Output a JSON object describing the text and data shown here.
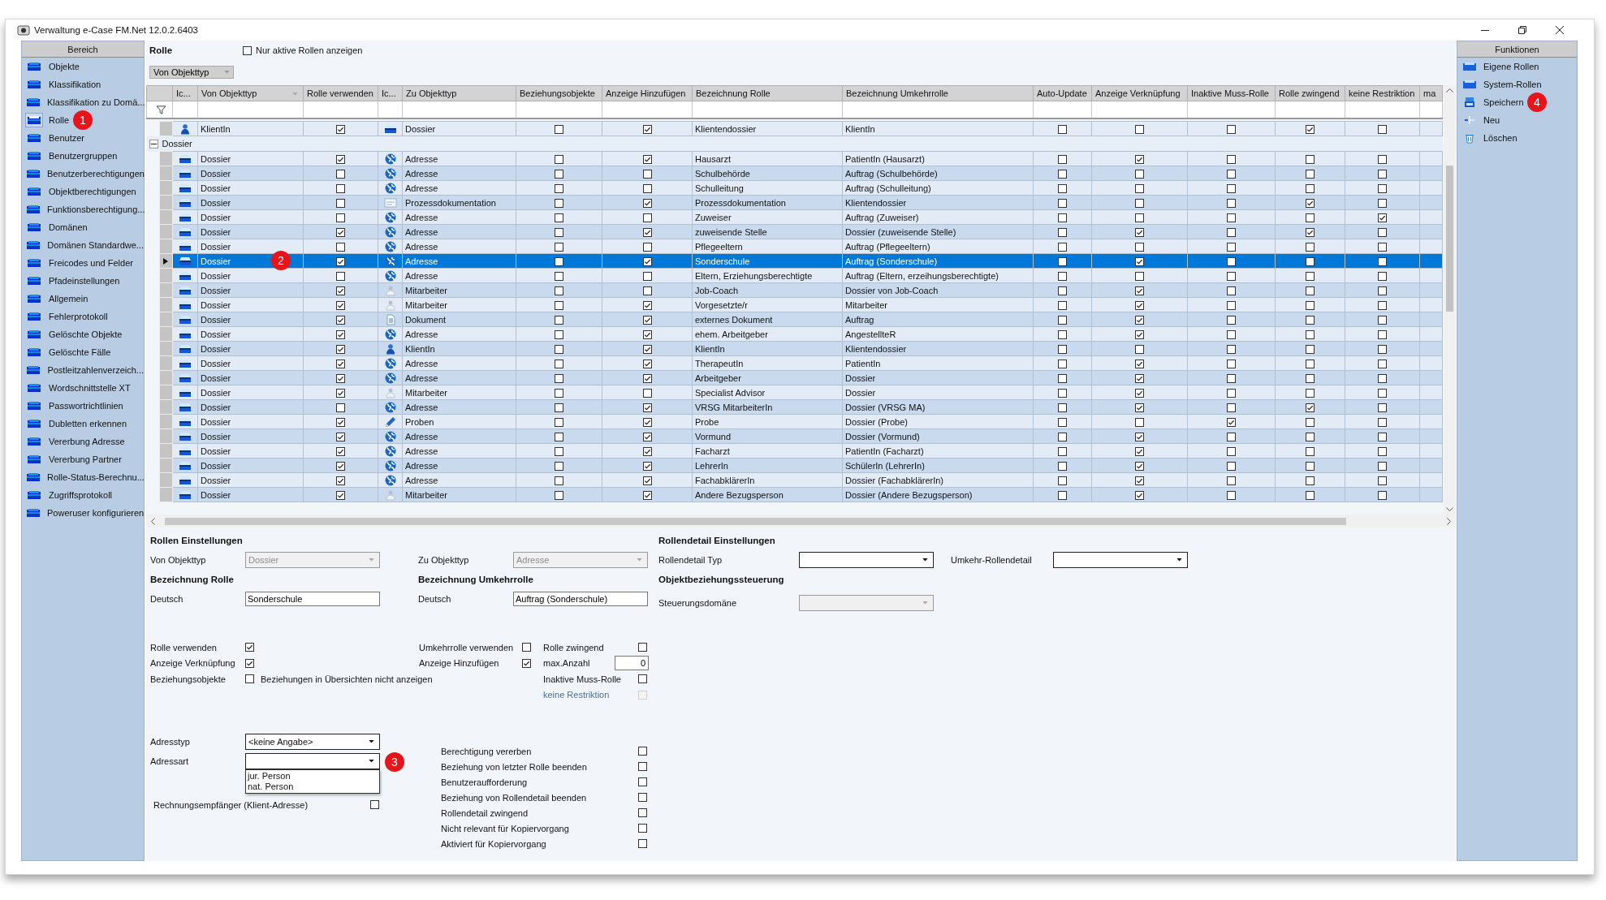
{
  "window": {
    "title": "Verwaltung e-Case FM.Net 12.0.2.6403"
  },
  "sidebar": {
    "title": "Bereich",
    "items": [
      {
        "label": "Objekte",
        "selected": false
      },
      {
        "label": "Klassifikation",
        "selected": false
      },
      {
        "label": "Klassifikation zu Domä...",
        "selected": false
      },
      {
        "label": "Rolle",
        "selected": true,
        "callout": "1"
      },
      {
        "label": "Benutzer",
        "selected": false
      },
      {
        "label": "Benutzergruppen",
        "selected": false
      },
      {
        "label": "Benutzerberechtigungen",
        "selected": false
      },
      {
        "label": "Objektberechtigungen",
        "selected": false
      },
      {
        "label": "Funktionsberechtigung...",
        "selected": false
      },
      {
        "label": "Domänen",
        "selected": false
      },
      {
        "label": "Domänen Standardwe...",
        "selected": false
      },
      {
        "label": "Freicodes und Felder",
        "selected": false
      },
      {
        "label": "Pfadeinstellungen",
        "selected": false
      },
      {
        "label": "Allgemein",
        "selected": false
      },
      {
        "label": "Fehlerprotokoll",
        "selected": false
      },
      {
        "label": "Gelöschte Objekte",
        "selected": false
      },
      {
        "label": "Gelöschte Fälle",
        "selected": false
      },
      {
        "label": "Postleitzahlenverzeich...",
        "selected": false
      },
      {
        "label": "Wordschnittstelle XT",
        "selected": false
      },
      {
        "label": "Passwortrichtlinien",
        "selected": false
      },
      {
        "label": "Dubletten erkennen",
        "selected": false
      },
      {
        "label": "Vererbung Adresse",
        "selected": false
      },
      {
        "label": "Vererbung Partner",
        "selected": false
      },
      {
        "label": "Rolle-Status-Berechnu...",
        "selected": false
      },
      {
        "label": "Zugriffsprotokoll",
        "selected": false
      },
      {
        "label": "Poweruser konfigurieren",
        "selected": false
      }
    ]
  },
  "main": {
    "title": "Rolle",
    "active_only": {
      "label": "Nur aktive Rollen anzeigen",
      "checked": false
    },
    "group_by": "Von Objekttyp"
  },
  "grid": {
    "columns": [
      "Ic...",
      "Von Objekttyp",
      "Rolle verwenden",
      "Ic...",
      "Zu Objekttyp",
      "Beziehungsobjekte",
      "Anzeige Hinzufügen",
      "Bezeichnung Rolle",
      "Bezeichnung Umkehrrolle",
      "Auto-Update",
      "Anzeige Verknüpfung",
      "Inaktive Muss-Rolle",
      "Rolle zwingend",
      "keine Restriktion",
      "ma"
    ],
    "pinned_row": {
      "from": {
        "kind": "client",
        "label": "KlientIn"
      },
      "use_role": true,
      "to": {
        "kind": "dossier",
        "label": "Dossier"
      },
      "relation_objects": false,
      "show_add": true,
      "role": "Klientendossier",
      "reverse_role": "KlientIn",
      "auto_update": false,
      "show_link": false,
      "inactive_required": false,
      "role_required": true,
      "no_restriction": false
    },
    "group": {
      "label": "Dossier",
      "expanded": true
    },
    "rows": [
      {
        "from": {
          "kind": "dossier",
          "label": "Dossier"
        },
        "use_role": true,
        "to": {
          "kind": "address",
          "label": "Adresse"
        },
        "relation_objects": false,
        "show_add": true,
        "role": "Hausarzt",
        "reverse_role": "PatientIn (Hausarzt)",
        "auto_update": false,
        "show_link": true,
        "inactive_required": false,
        "role_required": false,
        "no_restriction": false,
        "selected": false
      },
      {
        "from": {
          "kind": "dossier",
          "label": "Dossier"
        },
        "use_role": false,
        "to": {
          "kind": "address",
          "label": "Adresse"
        },
        "relation_objects": false,
        "show_add": false,
        "role": "Schulbehörde",
        "reverse_role": "Auftrag (Schulbehörde)",
        "auto_update": false,
        "show_link": false,
        "inactive_required": false,
        "role_required": false,
        "no_restriction": false,
        "selected": false
      },
      {
        "from": {
          "kind": "dossier",
          "label": "Dossier"
        },
        "use_role": false,
        "to": {
          "kind": "address",
          "label": "Adresse"
        },
        "relation_objects": false,
        "show_add": false,
        "role": "Schulleitung",
        "reverse_role": "Auftrag (Schulleitung)",
        "auto_update": false,
        "show_link": false,
        "inactive_required": false,
        "role_required": false,
        "no_restriction": false,
        "selected": false
      },
      {
        "from": {
          "kind": "dossier",
          "label": "Dossier"
        },
        "use_role": false,
        "to": {
          "kind": "process",
          "label": "Prozessdokumentation"
        },
        "relation_objects": false,
        "show_add": true,
        "role": "Prozessdokumentation",
        "reverse_role": "Klientendossier",
        "auto_update": false,
        "show_link": false,
        "inactive_required": false,
        "role_required": true,
        "no_restriction": false,
        "selected": false
      },
      {
        "from": {
          "kind": "dossier",
          "label": "Dossier"
        },
        "use_role": false,
        "to": {
          "kind": "address",
          "label": "Adresse"
        },
        "relation_objects": false,
        "show_add": false,
        "role": "Zuweiser",
        "reverse_role": "Auftrag (Zuweiser)",
        "auto_update": false,
        "show_link": false,
        "inactive_required": false,
        "role_required": false,
        "no_restriction": true,
        "selected": false
      },
      {
        "from": {
          "kind": "dossier",
          "label": "Dossier"
        },
        "use_role": true,
        "to": {
          "kind": "address",
          "label": "Adresse"
        },
        "relation_objects": false,
        "show_add": true,
        "role": "zuweisende Stelle",
        "reverse_role": "Dossier (zuweisende Stelle)",
        "auto_update": false,
        "show_link": true,
        "inactive_required": false,
        "role_required": true,
        "no_restriction": false,
        "selected": false
      },
      {
        "from": {
          "kind": "dossier",
          "label": "Dossier"
        },
        "use_role": false,
        "to": {
          "kind": "address",
          "label": "Adresse"
        },
        "relation_objects": false,
        "show_add": false,
        "role": "Pflegeeltern",
        "reverse_role": "Auftrag (Pflegeeltern)",
        "auto_update": false,
        "show_link": false,
        "inactive_required": false,
        "role_required": false,
        "no_restriction": false,
        "selected": false
      },
      {
        "from": {
          "kind": "dossier",
          "label": "Dossier"
        },
        "use_role": true,
        "to": {
          "kind": "address",
          "label": "Adresse"
        },
        "relation_objects": false,
        "show_add": true,
        "role": "Sonderschule",
        "reverse_role": "Auftrag (Sonderschule)",
        "auto_update": false,
        "show_link": true,
        "inactive_required": false,
        "role_required": false,
        "no_restriction": false,
        "selected": true,
        "callout": "2"
      },
      {
        "from": {
          "kind": "dossier",
          "label": "Dossier"
        },
        "use_role": false,
        "to": {
          "kind": "address",
          "label": "Adresse"
        },
        "relation_objects": false,
        "show_add": false,
        "role": "Eltern, Erziehungsberechtigte",
        "reverse_role": "Auftrag (Eltern, erzeihungsberechtigte)",
        "auto_update": false,
        "show_link": false,
        "inactive_required": false,
        "role_required": false,
        "no_restriction": false,
        "selected": false
      },
      {
        "from": {
          "kind": "dossier",
          "label": "Dossier"
        },
        "use_role": true,
        "to": {
          "kind": "employee",
          "label": "Mitarbeiter"
        },
        "relation_objects": false,
        "show_add": false,
        "role": "Job-Coach",
        "reverse_role": "Dossier von Job-Coach",
        "auto_update": false,
        "show_link": true,
        "inactive_required": false,
        "role_required": false,
        "no_restriction": false,
        "selected": false
      },
      {
        "from": {
          "kind": "dossier",
          "label": "Dossier"
        },
        "use_role": true,
        "to": {
          "kind": "employee",
          "label": "Mitarbeiter"
        },
        "relation_objects": false,
        "show_add": true,
        "role": "Vorgesetzte/r",
        "reverse_role": "Mitarbeiter",
        "auto_update": false,
        "show_link": true,
        "inactive_required": false,
        "role_required": false,
        "no_restriction": false,
        "selected": false
      },
      {
        "from": {
          "kind": "dossier",
          "label": "Dossier"
        },
        "use_role": true,
        "to": {
          "kind": "document",
          "label": "Dokument"
        },
        "relation_objects": false,
        "show_add": true,
        "role": "externes Dokument",
        "reverse_role": "Auftrag",
        "auto_update": false,
        "show_link": true,
        "inactive_required": false,
        "role_required": false,
        "no_restriction": false,
        "selected": false
      },
      {
        "from": {
          "kind": "dossier",
          "label": "Dossier"
        },
        "use_role": true,
        "to": {
          "kind": "address",
          "label": "Adresse"
        },
        "relation_objects": false,
        "show_add": true,
        "role": "ehem. Arbeitgeber",
        "reverse_role": "AngestellteR",
        "auto_update": false,
        "show_link": true,
        "inactive_required": false,
        "role_required": false,
        "no_restriction": false,
        "selected": false
      },
      {
        "from": {
          "kind": "dossier",
          "label": "Dossier"
        },
        "use_role": true,
        "to": {
          "kind": "client",
          "label": "KlientIn"
        },
        "relation_objects": false,
        "show_add": true,
        "role": "KlientIn",
        "reverse_role": "Klientendossier",
        "auto_update": false,
        "show_link": false,
        "inactive_required": false,
        "role_required": false,
        "no_restriction": false,
        "selected": false
      },
      {
        "from": {
          "kind": "dossier",
          "label": "Dossier"
        },
        "use_role": true,
        "to": {
          "kind": "address",
          "label": "Adresse"
        },
        "relation_objects": false,
        "show_add": true,
        "role": "TherapeutIn",
        "reverse_role": "PatientIn",
        "auto_update": false,
        "show_link": true,
        "inactive_required": false,
        "role_required": false,
        "no_restriction": false,
        "selected": false
      },
      {
        "from": {
          "kind": "dossier",
          "label": "Dossier"
        },
        "use_role": true,
        "to": {
          "kind": "address",
          "label": "Adresse"
        },
        "relation_objects": false,
        "show_add": true,
        "role": "Arbeitgeber",
        "reverse_role": "Dossier",
        "auto_update": false,
        "show_link": true,
        "inactive_required": false,
        "role_required": false,
        "no_restriction": false,
        "selected": false
      },
      {
        "from": {
          "kind": "dossier",
          "label": "Dossier"
        },
        "use_role": true,
        "to": {
          "kind": "employee",
          "label": "Mitarbeiter"
        },
        "relation_objects": false,
        "show_add": false,
        "role": "Specialist Advisor",
        "reverse_role": "Dossier",
        "auto_update": false,
        "show_link": true,
        "inactive_required": false,
        "role_required": false,
        "no_restriction": false,
        "selected": false
      },
      {
        "from": {
          "kind": "dossier",
          "label": "Dossier"
        },
        "use_role": false,
        "to": {
          "kind": "address",
          "label": "Adresse"
        },
        "relation_objects": false,
        "show_add": true,
        "role": "VRSG MitarbeiterIn",
        "reverse_role": "Dossier (VRSG MA)",
        "auto_update": false,
        "show_link": true,
        "inactive_required": false,
        "role_required": true,
        "no_restriction": false,
        "selected": false
      },
      {
        "from": {
          "kind": "dossier",
          "label": "Dossier"
        },
        "use_role": true,
        "to": {
          "kind": "sample",
          "label": "Proben"
        },
        "relation_objects": false,
        "show_add": true,
        "role": "Probe",
        "reverse_role": "Dossier (Probe)",
        "auto_update": false,
        "show_link": false,
        "inactive_required": true,
        "role_required": false,
        "no_restriction": false,
        "selected": false
      },
      {
        "from": {
          "kind": "dossier",
          "label": "Dossier"
        },
        "use_role": true,
        "to": {
          "kind": "address",
          "label": "Adresse"
        },
        "relation_objects": false,
        "show_add": true,
        "role": "Vormund",
        "reverse_role": "Dossier (Vormund)",
        "auto_update": false,
        "show_link": true,
        "inactive_required": false,
        "role_required": false,
        "no_restriction": false,
        "selected": false
      },
      {
        "from": {
          "kind": "dossier",
          "label": "Dossier"
        },
        "use_role": true,
        "to": {
          "kind": "address",
          "label": "Adresse"
        },
        "relation_objects": false,
        "show_add": true,
        "role": "Facharzt",
        "reverse_role": "PatientIn (Facharzt)",
        "auto_update": false,
        "show_link": true,
        "inactive_required": false,
        "role_required": false,
        "no_restriction": false,
        "selected": false
      },
      {
        "from": {
          "kind": "dossier",
          "label": "Dossier"
        },
        "use_role": true,
        "to": {
          "kind": "address",
          "label": "Adresse"
        },
        "relation_objects": false,
        "show_add": true,
        "role": "LehrerIn",
        "reverse_role": "SchülerIn (LehrerIn)",
        "auto_update": false,
        "show_link": true,
        "inactive_required": false,
        "role_required": false,
        "no_restriction": false,
        "selected": false
      },
      {
        "from": {
          "kind": "dossier",
          "label": "Dossier"
        },
        "use_role": true,
        "to": {
          "kind": "address",
          "label": "Adresse"
        },
        "relation_objects": false,
        "show_add": true,
        "role": "FachabklärerIn",
        "reverse_role": "Dossier (FachabklärerIn)",
        "auto_update": false,
        "show_link": true,
        "inactive_required": false,
        "role_required": false,
        "no_restriction": false,
        "selected": false
      },
      {
        "from": {
          "kind": "dossier",
          "label": "Dossier"
        },
        "use_role": true,
        "to": {
          "kind": "employee",
          "label": "Mitarbeiter"
        },
        "relation_objects": false,
        "show_add": true,
        "role": "Andere Bezugsperson",
        "reverse_role": "Dossier (Andere Bezugsperson)",
        "auto_update": false,
        "show_link": true,
        "inactive_required": false,
        "role_required": false,
        "no_restriction": false,
        "selected": false
      }
    ]
  },
  "form": {
    "role_settings": {
      "title": "Rollen Einstellungen",
      "from_type": {
        "label": "Von Objekttyp",
        "value": "Dossier",
        "disabled": true
      },
      "to_type": {
        "label": "Zu Objekttyp",
        "value": "Adresse",
        "disabled": true
      }
    },
    "detail_settings": {
      "title": "Rollendetail Einstellungen",
      "detail_type": {
        "label": "Rollendetail Typ",
        "disabled": false
      },
      "reverse_detail": {
        "label": "Umkehr-Rollendetail",
        "disabled": false
      }
    },
    "role_name": {
      "title": "Bezeichnung Rolle",
      "label": "Deutsch",
      "value": "Sonderschule"
    },
    "reverse_name": {
      "title": "Bezeichnung Umkehrrolle",
      "label": "Deutsch",
      "value": "Auftrag (Sonderschule)"
    },
    "control": {
      "title": "Objektbeziehungssteuerung",
      "domain": {
        "label": "Steuerungsdomäne",
        "disabled": true
      }
    },
    "flags_left": [
      {
        "label": "Rolle verwenden",
        "checked": true
      },
      {
        "label": "Anzeige Verknüpfung",
        "checked": true
      },
      {
        "label": "Beziehungsobjekte",
        "checked": false,
        "note": "Beziehungen in Übersichten nicht anzeigen"
      }
    ],
    "flags_mid": [
      {
        "label": "Umkehrrolle verwenden",
        "checked": false
      },
      {
        "label": "Anzeige Hinzufügen",
        "checked": true
      }
    ],
    "flags_right": [
      {
        "kind": "checkbox",
        "label": "Rolle zwingend",
        "checked": false,
        "disabled": false
      },
      {
        "kind": "number",
        "label": "max.Anzahl",
        "value": "0"
      },
      {
        "kind": "checkbox",
        "label": "Inaktive Muss-Rolle",
        "checked": false,
        "disabled": false
      },
      {
        "kind": "checkbox",
        "label": "keine Restriktion",
        "checked": false,
        "disabled": true
      }
    ],
    "address_type": {
      "label": "Adresstyp",
      "value": "<keine Angabe>"
    },
    "address_kind": {
      "label": "Adressart",
      "expanded": true,
      "options": [
        "jur. Person",
        "nat. Person"
      ],
      "callout": "3"
    },
    "invoice": {
      "label": "Rechnungsempfänger (Klient-Adresse)",
      "checked": false
    },
    "options": [
      {
        "label": "Berechtigung vererben",
        "checked": false
      },
      {
        "label": "Beziehung von letzter Rolle beenden",
        "checked": false
      },
      {
        "label": "Benutzeraufforderung",
        "checked": false
      },
      {
        "label": "Beziehung von Rollendetail beenden",
        "checked": false
      },
      {
        "label": "Rollendetail zwingend",
        "checked": false
      },
      {
        "label": "Nicht relevant für Kopiervorgang",
        "checked": false
      },
      {
        "label": "Aktiviert für Kopiervorgang",
        "checked": false
      }
    ]
  },
  "functions": {
    "title": "Funktionen",
    "items": [
      {
        "label": "Eigene Rollen",
        "kind": "roles"
      },
      {
        "label": "System-Rollen",
        "kind": "roles"
      },
      {
        "label": "Speichern",
        "kind": "save",
        "callout": "4"
      },
      {
        "label": "Neu",
        "kind": "new"
      },
      {
        "label": "Löschen",
        "kind": "delete"
      }
    ]
  }
}
